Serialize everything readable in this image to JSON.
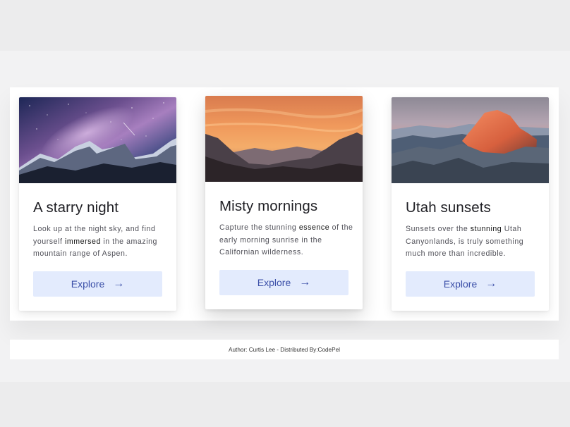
{
  "cards": [
    {
      "title": "A starry night",
      "text_before": "Look up at the night sky, and find yourself ",
      "emphasis": "immersed",
      "text_after": " in the amazing mountain range of Aspen.",
      "button_label": "Explore",
      "arrow": "→"
    },
    {
      "title": "Misty mornings",
      "text_before": "Capture the stunning ",
      "emphasis": "essence",
      "text_after": " of the early morning sunrise in the Californian wilderness.",
      "button_label": "Explore",
      "arrow": "→"
    },
    {
      "title": "Utah sunsets",
      "text_before": "Sunsets over the ",
      "emphasis": "stunning",
      "text_after": " Utah Canyonlands, is truly something much more than incredible.",
      "button_label": "Explore",
      "arrow": "→"
    }
  ],
  "footer": {
    "text": "Author: Curtis Lee - Distributed By:CodePel"
  },
  "colors": {
    "button_bg": "#e3ebfd",
    "button_text": "#3b4fa8",
    "page_bg": "#ececed"
  }
}
